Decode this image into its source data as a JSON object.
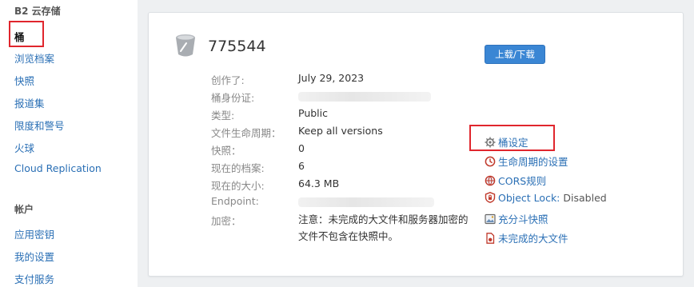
{
  "sidebar": {
    "header": "B2 云存储",
    "items": [
      {
        "label": "桶",
        "active": true
      },
      {
        "label": "浏览档案"
      },
      {
        "label": "快照"
      },
      {
        "label": "报道集"
      },
      {
        "label": "限度和警号"
      },
      {
        "label": "火球"
      },
      {
        "label": "Cloud Replication"
      }
    ],
    "account_header": "帐户",
    "account_items": [
      {
        "label": "应用密钥"
      },
      {
        "label": "我的设置"
      },
      {
        "label": "支付服务"
      }
    ]
  },
  "bucket": {
    "name": "775544",
    "upload_button": "上载/下载",
    "fields": [
      {
        "label": "创作了:",
        "value": "July 29, 2023"
      },
      {
        "label": "桶身份证:",
        "value": ""
      },
      {
        "label": "类型:",
        "value": "Public"
      },
      {
        "label": "文件生命周期：",
        "value": "Keep all versions"
      },
      {
        "label": "快照：",
        "value": "0"
      },
      {
        "label": "现在的档案:",
        "value": "6"
      },
      {
        "label": "现在的大小:",
        "value": "64.3 MB"
      },
      {
        "label": "Endpoint:",
        "value": ""
      },
      {
        "label": "加密：",
        "value": "注意：未完成的大文件和服务器加密的文件不包含在快照中。"
      }
    ],
    "actions": [
      {
        "label": "桶设定",
        "icon": "gear-icon"
      },
      {
        "label": "生命周期的设置",
        "icon": "clock-icon"
      },
      {
        "label": "CORS规则",
        "icon": "globe-icon"
      },
      {
        "label": "Object Lock:",
        "suffix": "Disabled",
        "icon": "shield-lock-icon"
      },
      {
        "label": "充分斗快照",
        "icon": "image-icon"
      },
      {
        "label": "未完成的大文件",
        "icon": "file-icon"
      }
    ]
  },
  "colors": {
    "link": "#2a6fb5",
    "button": "#3a86d4",
    "highlight": "#e0262d"
  }
}
